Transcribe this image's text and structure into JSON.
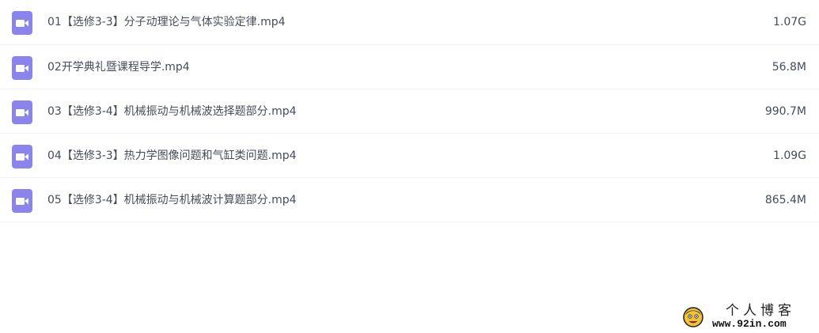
{
  "files": [
    {
      "name": "01【选修3-3】分子动理论与气体实验定律.mp4",
      "size": "1.07G",
      "icon": "video-file-icon"
    },
    {
      "name": "02开学典礼暨课程导学.mp4",
      "size": "56.8M",
      "icon": "video-file-icon"
    },
    {
      "name": "03【选修3-4】机械振动与机械波选择题部分.mp4",
      "size": "990.7M",
      "icon": "video-file-icon"
    },
    {
      "name": "04【选修3-3】热力学图像问题和气缸类问题.mp4",
      "size": "1.09G",
      "icon": "video-file-icon"
    },
    {
      "name": "05【选修3-4】机械振动与机械波计算题部分.mp4",
      "size": "865.4M",
      "icon": "video-file-icon"
    }
  ],
  "watermark": {
    "title": "个人博客",
    "url": "www.92in.com"
  },
  "colors": {
    "icon_accent": "#8a84ec",
    "text": "#454d5a",
    "divider": "#eef0f4"
  }
}
